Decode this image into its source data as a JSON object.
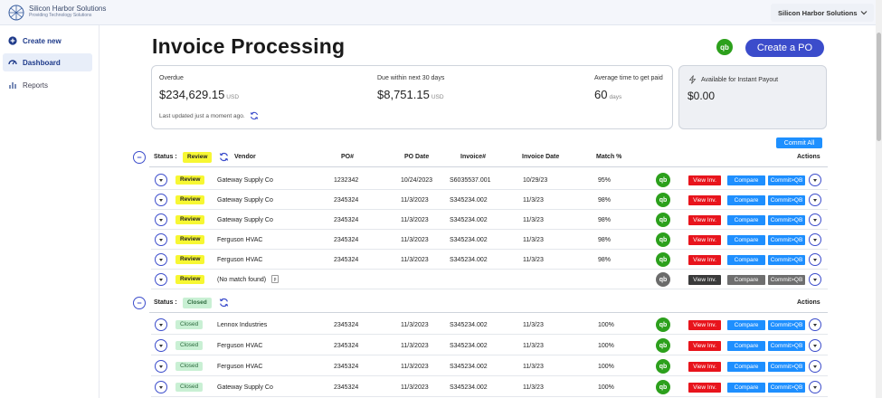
{
  "header": {
    "logo_name": "Silicon Harbor Solutions",
    "logo_tagline": "Providing Technology Solutions",
    "company_selector": "Silicon Harbor Solutions"
  },
  "sidebar": {
    "items": [
      {
        "label": "Create new",
        "icon": "plus-circle-icon"
      },
      {
        "label": "Dashboard",
        "icon": "gauge-icon"
      },
      {
        "label": "Reports",
        "icon": "bar-chart-icon"
      }
    ]
  },
  "page": {
    "title": "Invoice Processing",
    "qb_label": "qb",
    "create_po_label": "Create a PO"
  },
  "summary": {
    "overdue_label": "Overdue",
    "overdue_value": "$234,629.15",
    "due_label": "Due within next 30 days",
    "due_value": "$8,751.15",
    "currency": "USD",
    "avg_label": "Average time to get paid",
    "avg_value": "60",
    "avg_unit": "days",
    "updated": "Last updated just a moment ago."
  },
  "payout": {
    "label": "Available for Instant Payout",
    "value": "$0.00"
  },
  "commit_all_label": "Commit All",
  "columns": {
    "status": "Status :",
    "vendor": "Vendor",
    "po": "PO#",
    "po_date": "PO Date",
    "invoice": "Invoice#",
    "invoice_date": "Invoice Date",
    "match": "Match %",
    "actions": "Actions"
  },
  "buttons": {
    "view": "View Inv.",
    "compare": "Compare",
    "commit": "Commit>QB"
  },
  "groups": [
    {
      "status": "Review",
      "rows": [
        {
          "status": "Review",
          "vendor": "Gateway Supply Co",
          "po": "1232342",
          "po_date": "10/24/2023",
          "invoice": "S6035537.001",
          "invoice_date": "10/29/23",
          "match": "95%",
          "enabled": true
        },
        {
          "status": "Review",
          "vendor": "Gateway Supply Co",
          "po": "2345324",
          "po_date": "11/3/2023",
          "invoice": "S345234.002",
          "invoice_date": "11/3/23",
          "match": "98%",
          "enabled": true
        },
        {
          "status": "Review",
          "vendor": "Gateway Supply Co",
          "po": "2345324",
          "po_date": "11/3/2023",
          "invoice": "S345234.002",
          "invoice_date": "11/3/23",
          "match": "98%",
          "enabled": true
        },
        {
          "status": "Review",
          "vendor": "Ferguson HVAC",
          "po": "2345324",
          "po_date": "11/3/2023",
          "invoice": "S345234.002",
          "invoice_date": "11/3/23",
          "match": "98%",
          "enabled": true
        },
        {
          "status": "Review",
          "vendor": "Ferguson HVAC",
          "po": "2345324",
          "po_date": "11/3/2023",
          "invoice": "S345234.002",
          "invoice_date": "11/3/23",
          "match": "98%",
          "enabled": true
        },
        {
          "status": "Review",
          "vendor": "(No match found)",
          "po": "",
          "po_date": "",
          "invoice": "",
          "invoice_date": "",
          "match": "",
          "enabled": false
        }
      ]
    },
    {
      "status": "Closed",
      "rows": [
        {
          "status": "Closed",
          "vendor": "Lennox Industries",
          "po": "2345324",
          "po_date": "11/3/2023",
          "invoice": "S345234.002",
          "invoice_date": "11/3/23",
          "match": "100%",
          "enabled": true
        },
        {
          "status": "Closed",
          "vendor": "Ferguson HVAC",
          "po": "2345324",
          "po_date": "11/3/2023",
          "invoice": "S345234.002",
          "invoice_date": "11/3/23",
          "match": "100%",
          "enabled": true
        },
        {
          "status": "Closed",
          "vendor": "Ferguson HVAC",
          "po": "2345324",
          "po_date": "11/3/2023",
          "invoice": "S345234.002",
          "invoice_date": "11/3/23",
          "match": "100%",
          "enabled": true
        },
        {
          "status": "Closed",
          "vendor": "Gateway Supply Co",
          "po": "2345324",
          "po_date": "11/3/2023",
          "invoice": "S345234.002",
          "invoice_date": "11/3/23",
          "match": "100%",
          "enabled": true
        }
      ]
    }
  ],
  "colors": {
    "primary": "#3b4ccb",
    "qb_green": "#2ca01c",
    "view_red": "#e8141c",
    "action_blue": "#1e8fff",
    "review_yellow": "#f7f733",
    "closed_green": "#c9f0d4"
  }
}
